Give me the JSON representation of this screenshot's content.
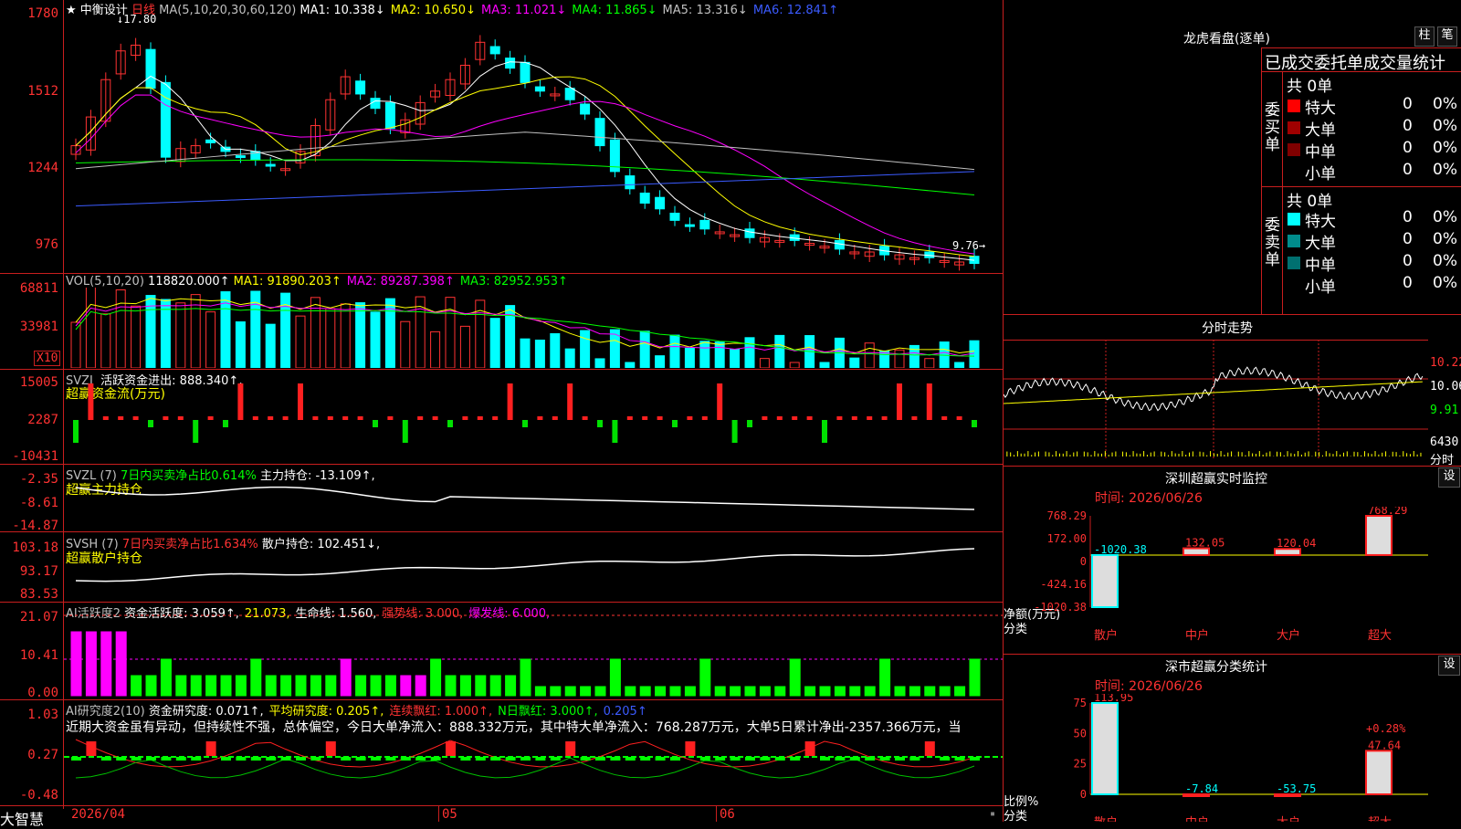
{
  "stock": {
    "name": "中衡设计",
    "period": "日线",
    "ma_label": "MA(5,10,20,30,60,120)",
    "ma_items": [
      {
        "text": "MA1: 10.338↓",
        "color": "#ffffff"
      },
      {
        "text": "MA2: 10.650↓",
        "color": "#ffff00"
      },
      {
        "text": "MA3: 11.021↓",
        "color": "#ff00ff"
      },
      {
        "text": "MA4: 11.865↓",
        "color": "#00ff00"
      },
      {
        "text": "MA5: 13.316↓",
        "color": "#c0c0c0"
      },
      {
        "text": "MA6: 12.841↑",
        "color": "#3b5bff"
      }
    ],
    "high_marker": "17.80",
    "low_marker": "9.76→",
    "price_ticks": [
      "1780",
      "1512",
      "1244",
      "976"
    ]
  },
  "vol": {
    "label": "VOL(5,10,20)",
    "value": "118820.000↑",
    "items": [
      {
        "text": "MA1: 91890.203↑",
        "color": "#ffff00"
      },
      {
        "text": "MA2: 89287.398↑",
        "color": "#ff00ff"
      },
      {
        "text": "MA3: 82952.953↑",
        "color": "#00ff00"
      }
    ],
    "ticks": [
      "68811",
      "33981"
    ],
    "unit": "X10"
  },
  "svzj": {
    "label": "SVZJ",
    "title": "活跃资金进出: 888.340↑,",
    "subtitle": "超赢资金流(万元)",
    "ticks": [
      "15005",
      "2287",
      "-10431"
    ]
  },
  "svzl": {
    "label": "SVZL (7)",
    "ratio": "7日内买卖净占比0.614%",
    "title": "主力持仓: -13.109↑,",
    "subtitle": "超赢主力持仓",
    "ticks": [
      "-2.35",
      "-8.61",
      "-14.87"
    ]
  },
  "svsh": {
    "label": "SVSH (7)",
    "ratio": "7日内买卖净占比1.634%",
    "title": "散户持仓: 102.451↓,",
    "subtitle": "超赢散户持仓",
    "ticks": [
      "103.18",
      "93.17",
      "83.53"
    ]
  },
  "ai1": {
    "label": "AI活跃度2",
    "items": [
      {
        "text": "资金活跃度: 3.059↑,",
        "color": "#ffffff"
      },
      {
        "text": "21.073,",
        "color": "#ffff00"
      },
      {
        "text": "生命线: 1.560,",
        "color": "#ffffff"
      },
      {
        "text": "强势线: 3.000,",
        "color": "#ff3232"
      },
      {
        "text": "爆发线: 6.000,",
        "color": "#ff00ff"
      }
    ],
    "ticks": [
      "21.07",
      "10.41",
      "0.00"
    ]
  },
  "ai2": {
    "label": "AI研究度2(10)",
    "items": [
      {
        "text": "资金研究度: 0.071↑,",
        "color": "#ffffff"
      },
      {
        "text": "平均研究度: 0.205↑,",
        "color": "#ffff00"
      },
      {
        "text": "连续飘红: 1.000↑,",
        "color": "#ff3232"
      },
      {
        "text": "N日飘红: 3.000↑,",
        "color": "#00ff00"
      },
      {
        "text": "0.205↑",
        "color": "#3b5bff"
      }
    ],
    "comment": "近期大资金虽有异动，但持续性不强，总体偏空，今日大单净流入：888.332万元，其中特大单净流入：768.287万元，大单5日累计净出-2357.366万元，当",
    "ticks": [
      "1.03",
      "0.27",
      "-0.48"
    ]
  },
  "xaxis": {
    "dates": [
      "2026/04",
      "05",
      "06"
    ],
    "brand": "大智慧"
  },
  "right": {
    "top_title": "龙虎看盘(逐单)",
    "btn_zhu": "柱",
    "btn_bi": "笔",
    "order_title": "已成交委托单成交量统计",
    "buy": {
      "side_label": "委买单",
      "total": "共 0单",
      "rows": [
        {
          "name": "特大",
          "count": "0",
          "pct": "0%",
          "color": "#ff0000"
        },
        {
          "name": "大单",
          "count": "0",
          "pct": "0%",
          "color": "#a00000"
        },
        {
          "name": "中单",
          "count": "0",
          "pct": "0%",
          "color": "#800000"
        },
        {
          "name": "小单",
          "count": "0",
          "pct": "0%",
          "color": ""
        }
      ]
    },
    "sell": {
      "side_label": "委卖单",
      "total": "共 0单",
      "rows": [
        {
          "name": "特大",
          "count": "0",
          "pct": "0%",
          "color": "#00ffff"
        },
        {
          "name": "大单",
          "count": "0",
          "pct": "0%",
          "color": "#008c8c"
        },
        {
          "name": "中单",
          "count": "0",
          "pct": "0%",
          "color": "#007070"
        },
        {
          "name": "小单",
          "count": "0",
          "pct": "0%",
          "color": ""
        }
      ]
    },
    "intraday": {
      "title": "分时走势",
      "ticks": [
        "10.22",
        "10.06",
        "9.91",
        "6430"
      ],
      "vol_label": "分时"
    },
    "monitor": {
      "title": "深圳超赢实时监控",
      "settings": "设",
      "time": "时间: 2026/06/26",
      "ticks": [
        "768.29",
        "172.00",
        "0",
        "-424.16",
        "-1020.38"
      ],
      "unit_label": "净额(万元)",
      "cat_label": "分类",
      "chart_data": {
        "type": "bar",
        "categories": [
          "散户",
          "中户",
          "大户",
          "超大"
        ],
        "values": [
          -1020.38,
          132.05,
          120.04,
          768.29
        ],
        "ylim": [
          -1020.38,
          768.29
        ]
      }
    },
    "classify": {
      "title": "深市超赢分类统计",
      "settings": "设",
      "time": "时间: 2026/06/26",
      "pct_label": "+0.28%",
      "ticks": [
        "75",
        "50",
        "25",
        "0"
      ],
      "unit_label": "比例%",
      "cat_label": "分类",
      "chart_data": {
        "type": "bar",
        "categories": [
          "散户",
          "中户",
          "大户",
          "超大"
        ],
        "values": [
          113.95,
          -7.84,
          -53.75,
          47.64
        ],
        "ylim": [
          0,
          100
        ]
      }
    }
  }
}
